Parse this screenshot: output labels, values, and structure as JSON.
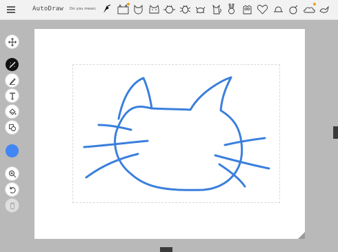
{
  "header": {
    "app_title": "AutoDraw",
    "suggest_label": "Do you mean:",
    "suggestions": [
      {
        "icon": "pencil-bird-icon"
      },
      {
        "icon": "cat-box-icon",
        "badge": true
      },
      {
        "icon": "cat-face-outline-icon"
      },
      {
        "icon": "cat-head-icon"
      },
      {
        "icon": "cat-whiskers-icon"
      },
      {
        "icon": "bug-icon"
      },
      {
        "icon": "crab-icon"
      },
      {
        "icon": "cat-sitting-icon"
      },
      {
        "icon": "bunny-icon"
      },
      {
        "icon": "owl-icon"
      },
      {
        "icon": "heart-face-icon"
      },
      {
        "icon": "hat-icon"
      },
      {
        "icon": "bomb-icon"
      },
      {
        "icon": "cloud-sun-icon",
        "badge": true
      },
      {
        "icon": "bird-icon"
      }
    ]
  },
  "toolbar": {
    "tools": [
      {
        "name": "move-tool",
        "icon": "move-arrows-icon"
      },
      {
        "name": "autodraw-tool",
        "icon": "autodraw-wand-icon",
        "active": true
      },
      {
        "name": "draw-tool",
        "icon": "pencil-icon"
      },
      {
        "name": "type-tool",
        "icon": "text-t-icon"
      },
      {
        "name": "fill-tool",
        "icon": "paint-bucket-icon"
      },
      {
        "name": "shape-tool",
        "icon": "shapes-icon"
      }
    ],
    "color": "#4285f4",
    "actions": [
      {
        "name": "zoom-tool",
        "icon": "zoom-in-icon"
      },
      {
        "name": "undo-button",
        "icon": "undo-icon"
      },
      {
        "name": "delete-button",
        "icon": "trash-icon",
        "disabled": true
      }
    ]
  },
  "canvas": {
    "stroke_color": "#3a7fdc",
    "background": "#ffffff"
  }
}
